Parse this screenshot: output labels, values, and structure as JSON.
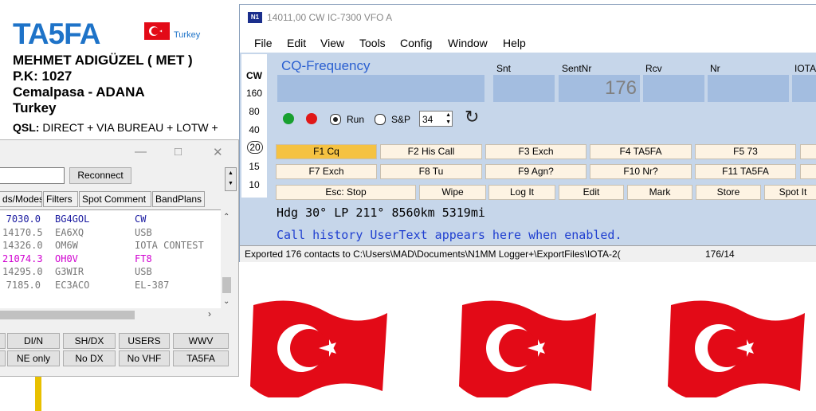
{
  "qsl_card": {
    "callsign": "TA5FA",
    "country_label": "Turkey",
    "name": "MEHMET ADIGÜZEL ( MET )",
    "po_box": "P.K: 1027",
    "city": "Cemalpasa - ADANA",
    "country": "Turkey",
    "qsl_label": "QSL:",
    "qsl_text": "DIRECT + VIA BUREAU + LOTW +",
    "flag_color": "#e30a17"
  },
  "telnet": {
    "min_icon": "minimize-icon",
    "max_icon": "maximize-icon",
    "close_icon": "close-icon",
    "reconnect": "Reconnect",
    "tabs": [
      "ds/Modes",
      "Filters",
      "Spot Comment",
      "BandPlans"
    ],
    "spots": [
      {
        "freq": "7030.0",
        "call": "BG4GOL",
        "mode": "CW",
        "color": "#1a1aa0"
      },
      {
        "freq": "14170.5",
        "call": "EA6XQ",
        "mode": "USB",
        "color": "#777777"
      },
      {
        "freq": "14326.0",
        "call": "OM6W",
        "mode": "IOTA CONTEST",
        "color": "#777777"
      },
      {
        "freq": "21074.3",
        "call": "OH0V",
        "mode": "FT8",
        "color": "#d000d0"
      },
      {
        "freq": "14295.0",
        "call": "G3WIR",
        "mode": "USB",
        "color": "#777777"
      },
      {
        "freq": "7185.0",
        "call": "EC3ACO",
        "mode": "EL-387",
        "color": "#777777"
      }
    ],
    "buttons_row1": [
      "DI/N",
      "SH/DX",
      "USERS",
      "WWV"
    ],
    "buttons_row2": [
      "NE only",
      "No DX",
      "No VHF",
      "TA5FA"
    ]
  },
  "entry": {
    "title": "14011,00 CW IC-7300 VFO A",
    "menu": [
      "File",
      "Edit",
      "View",
      "Tools",
      "Config",
      "Window",
      "Help"
    ],
    "mode": "CW",
    "bands": [
      "160",
      "80",
      "40",
      "20",
      "15",
      "10"
    ],
    "selected_band": "20",
    "cq_label": "CQ-Frequency",
    "field_labels": [
      "Snt",
      "SentNr",
      "Rcv",
      "Nr",
      "IOTA"
    ],
    "sent_nr": "176",
    "run_label": "Run",
    "sp_label": "S&P",
    "spin_value": "34",
    "fkeys_row1": [
      "F1 Cq",
      "F2 His Call",
      "F3 Exch",
      "F4 TA5FA",
      "F5 73"
    ],
    "fkeys_row2": [
      "F7 Exch",
      "F8 Tu",
      "F9 Agn?",
      "F10 Nr?",
      "F11 TA5FA"
    ],
    "buttons_row3": [
      "Esc: Stop",
      "Wipe",
      "Log It",
      "Edit",
      "Mark",
      "Store",
      "Spot It"
    ],
    "heading": "Hdg 30° LP 211° 8560km 5319mi",
    "call_history": "Call history UserText appears here when enabled.",
    "status_left": "Exported 176 contacts to C:\\Users\\MAD\\Documents\\N1MM Logger+\\ExportFiles\\IOTA-2(",
    "status_right": "176/14",
    "highlight": "#f5c242"
  }
}
